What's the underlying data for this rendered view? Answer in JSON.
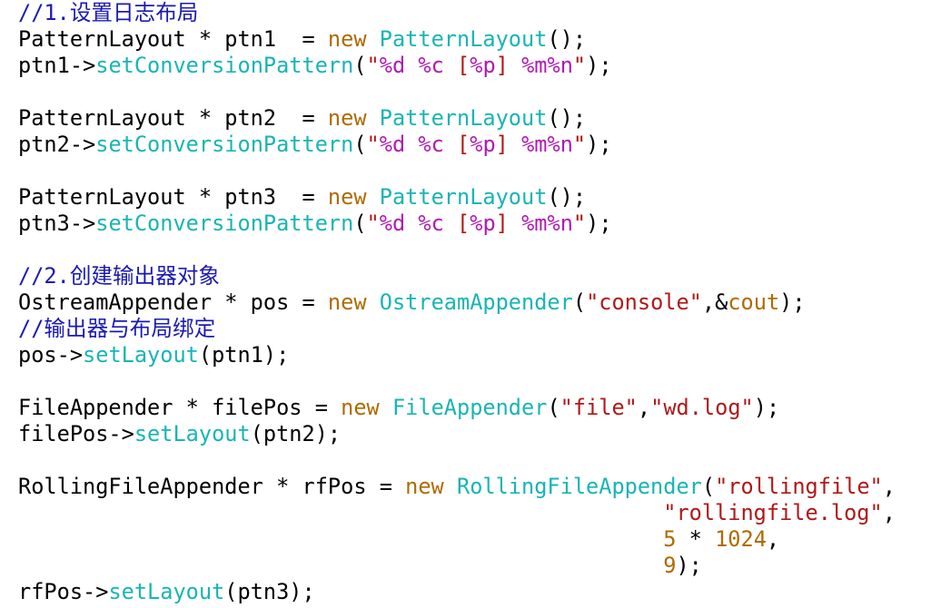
{
  "colors": {
    "comment": "#1a1ab4",
    "keyword": "#b06a00",
    "function": "#1ab4b4",
    "string": "#b01818",
    "format": "#b01ab4",
    "plain": "#000000"
  },
  "code_lines": [
    [
      [
        "comment",
        "//1.设置日志布局"
      ]
    ],
    [
      [
        "plain",
        "PatternLayout * ptn1  = "
      ],
      [
        "keyword",
        "new"
      ],
      [
        "plain",
        " "
      ],
      [
        "function",
        "PatternLayout"
      ],
      [
        "plain",
        "();"
      ]
    ],
    [
      [
        "plain",
        "ptn1->"
      ],
      [
        "function",
        "setConversionPattern"
      ],
      [
        "plain",
        "("
      ],
      [
        "string",
        "\""
      ],
      [
        "format",
        "%d"
      ],
      [
        "string",
        " "
      ],
      [
        "format",
        "%c"
      ],
      [
        "string",
        " ["
      ],
      [
        "format",
        "%p"
      ],
      [
        "string",
        "] "
      ],
      [
        "format",
        "%m%n"
      ],
      [
        "string",
        "\""
      ],
      [
        "plain",
        ");"
      ]
    ],
    [],
    [
      [
        "plain",
        "PatternLayout * ptn2  = "
      ],
      [
        "keyword",
        "new"
      ],
      [
        "plain",
        " "
      ],
      [
        "function",
        "PatternLayout"
      ],
      [
        "plain",
        "();"
      ]
    ],
    [
      [
        "plain",
        "ptn2->"
      ],
      [
        "function",
        "setConversionPattern"
      ],
      [
        "plain",
        "("
      ],
      [
        "string",
        "\""
      ],
      [
        "format",
        "%d"
      ],
      [
        "string",
        " "
      ],
      [
        "format",
        "%c"
      ],
      [
        "string",
        " ["
      ],
      [
        "format",
        "%p"
      ],
      [
        "string",
        "] "
      ],
      [
        "format",
        "%m%n"
      ],
      [
        "string",
        "\""
      ],
      [
        "plain",
        ");"
      ]
    ],
    [],
    [
      [
        "plain",
        "PatternLayout * ptn3  = "
      ],
      [
        "keyword",
        "new"
      ],
      [
        "plain",
        " "
      ],
      [
        "function",
        "PatternLayout"
      ],
      [
        "plain",
        "();"
      ]
    ],
    [
      [
        "plain",
        "ptn3->"
      ],
      [
        "function",
        "setConversionPattern"
      ],
      [
        "plain",
        "("
      ],
      [
        "string",
        "\""
      ],
      [
        "format",
        "%d"
      ],
      [
        "string",
        " "
      ],
      [
        "format",
        "%c"
      ],
      [
        "string",
        " ["
      ],
      [
        "format",
        "%p"
      ],
      [
        "string",
        "] "
      ],
      [
        "format",
        "%m%n"
      ],
      [
        "string",
        "\""
      ],
      [
        "plain",
        ");"
      ]
    ],
    [],
    [
      [
        "comment",
        "//2.创建输出器对象"
      ]
    ],
    [
      [
        "plain",
        "OstreamAppender * pos = "
      ],
      [
        "keyword",
        "new"
      ],
      [
        "plain",
        " "
      ],
      [
        "function",
        "OstreamAppender"
      ],
      [
        "plain",
        "("
      ],
      [
        "string",
        "\"console\""
      ],
      [
        "plain",
        ",&"
      ],
      [
        "keyword",
        "cout"
      ],
      [
        "plain",
        ");"
      ]
    ],
    [
      [
        "comment",
        "//输出器与布局绑定"
      ]
    ],
    [
      [
        "plain",
        "pos->"
      ],
      [
        "function",
        "setLayout"
      ],
      [
        "plain",
        "(ptn1);"
      ]
    ],
    [],
    [
      [
        "plain",
        "FileAppender * filePos = "
      ],
      [
        "keyword",
        "new"
      ],
      [
        "plain",
        " "
      ],
      [
        "function",
        "FileAppender"
      ],
      [
        "plain",
        "("
      ],
      [
        "string",
        "\"file\""
      ],
      [
        "plain",
        ","
      ],
      [
        "string",
        "\"wd.log\""
      ],
      [
        "plain",
        ");"
      ]
    ],
    [
      [
        "plain",
        "filePos->"
      ],
      [
        "function",
        "setLayout"
      ],
      [
        "plain",
        "(ptn2);"
      ]
    ],
    [],
    [
      [
        "plain",
        "RollingFileAppender * rfPos = "
      ],
      [
        "keyword",
        "new"
      ],
      [
        "plain",
        " "
      ],
      [
        "function",
        "RollingFileAppender"
      ],
      [
        "plain",
        "("
      ],
      [
        "string",
        "\"rollingfile\""
      ],
      [
        "plain",
        ","
      ]
    ],
    [
      [
        "plain",
        "                                                  "
      ],
      [
        "string",
        "\"rollingfile.log\""
      ],
      [
        "plain",
        ","
      ]
    ],
    [
      [
        "plain",
        "                                                  "
      ],
      [
        "keyword",
        "5"
      ],
      [
        "plain",
        " * "
      ],
      [
        "keyword",
        "1024"
      ],
      [
        "plain",
        ","
      ]
    ],
    [
      [
        "plain",
        "                                                  "
      ],
      [
        "keyword",
        "9"
      ],
      [
        "plain",
        ");"
      ]
    ],
    [
      [
        "plain",
        "rfPos->"
      ],
      [
        "function",
        "setLayout"
      ],
      [
        "plain",
        "(ptn3);"
      ]
    ]
  ]
}
